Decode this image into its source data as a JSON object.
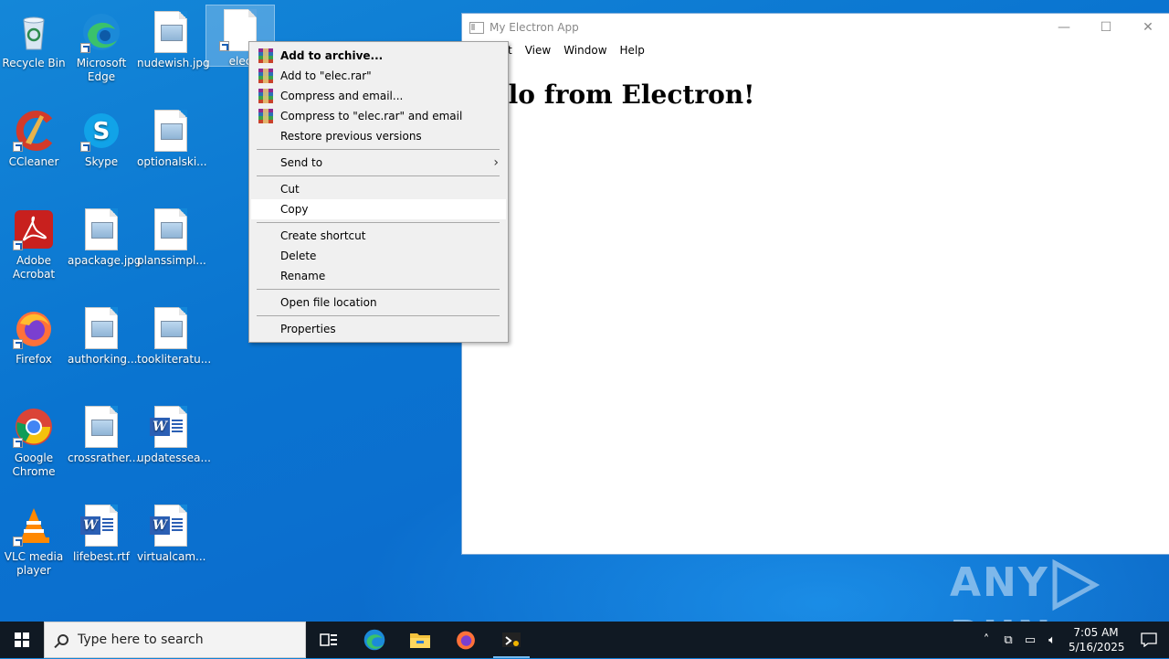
{
  "desktop": {
    "icons": [
      {
        "label": "Recycle Bin"
      },
      {
        "label": "Microsoft Edge"
      },
      {
        "label": "nudewish.jpg"
      },
      {
        "label": "elec"
      },
      {
        "label": "CCleaner"
      },
      {
        "label": "Skype"
      },
      {
        "label": "optionalski..."
      },
      {
        "label": "Adobe Acrobat"
      },
      {
        "label": "apackage.jpg"
      },
      {
        "label": "planssimpl..."
      },
      {
        "label": "Firefox"
      },
      {
        "label": "authorking..."
      },
      {
        "label": "tookliteratu..."
      },
      {
        "label": "Google Chrome"
      },
      {
        "label": "crossrather..."
      },
      {
        "label": "updatessea..."
      },
      {
        "label": "VLC media player"
      },
      {
        "label": "lifebest.rtf"
      },
      {
        "label": "virtualcam..."
      }
    ]
  },
  "window": {
    "title": "My Electron App",
    "menu": [
      "t",
      "View",
      "Window",
      "Help"
    ],
    "content_heading": "llo from Electron!",
    "controls": {
      "minimize": "—",
      "maximize": "☐",
      "close": "✕"
    }
  },
  "context_menu": {
    "items": [
      {
        "label": "Add to archive...",
        "icon": "winrar-icon"
      },
      {
        "label": "Add to \"elec.rar\"",
        "icon": "winrar-icon"
      },
      {
        "label": "Compress and email...",
        "icon": "winrar-icon"
      },
      {
        "label": "Compress to \"elec.rar\" and email",
        "icon": "winrar-icon"
      },
      {
        "label": "Restore previous versions"
      },
      {
        "label": "Send to"
      },
      {
        "label": "Cut"
      },
      {
        "label": "Copy"
      },
      {
        "label": "Create shortcut"
      },
      {
        "label": "Delete"
      },
      {
        "label": "Rename"
      },
      {
        "label": "Open file location"
      },
      {
        "label": "Properties"
      }
    ],
    "hovered": "Copy"
  },
  "watermark": {
    "text_left": "ANY",
    "text_right": "RUN"
  },
  "taskbar": {
    "search_placeholder": "Type here to search",
    "time": "7:05 AM",
    "date": "5/16/2025",
    "pinned": [
      "task-view-icon",
      "edge-icon",
      "file-explorer-icon",
      "firefox-icon",
      "electron-app-icon"
    ]
  }
}
